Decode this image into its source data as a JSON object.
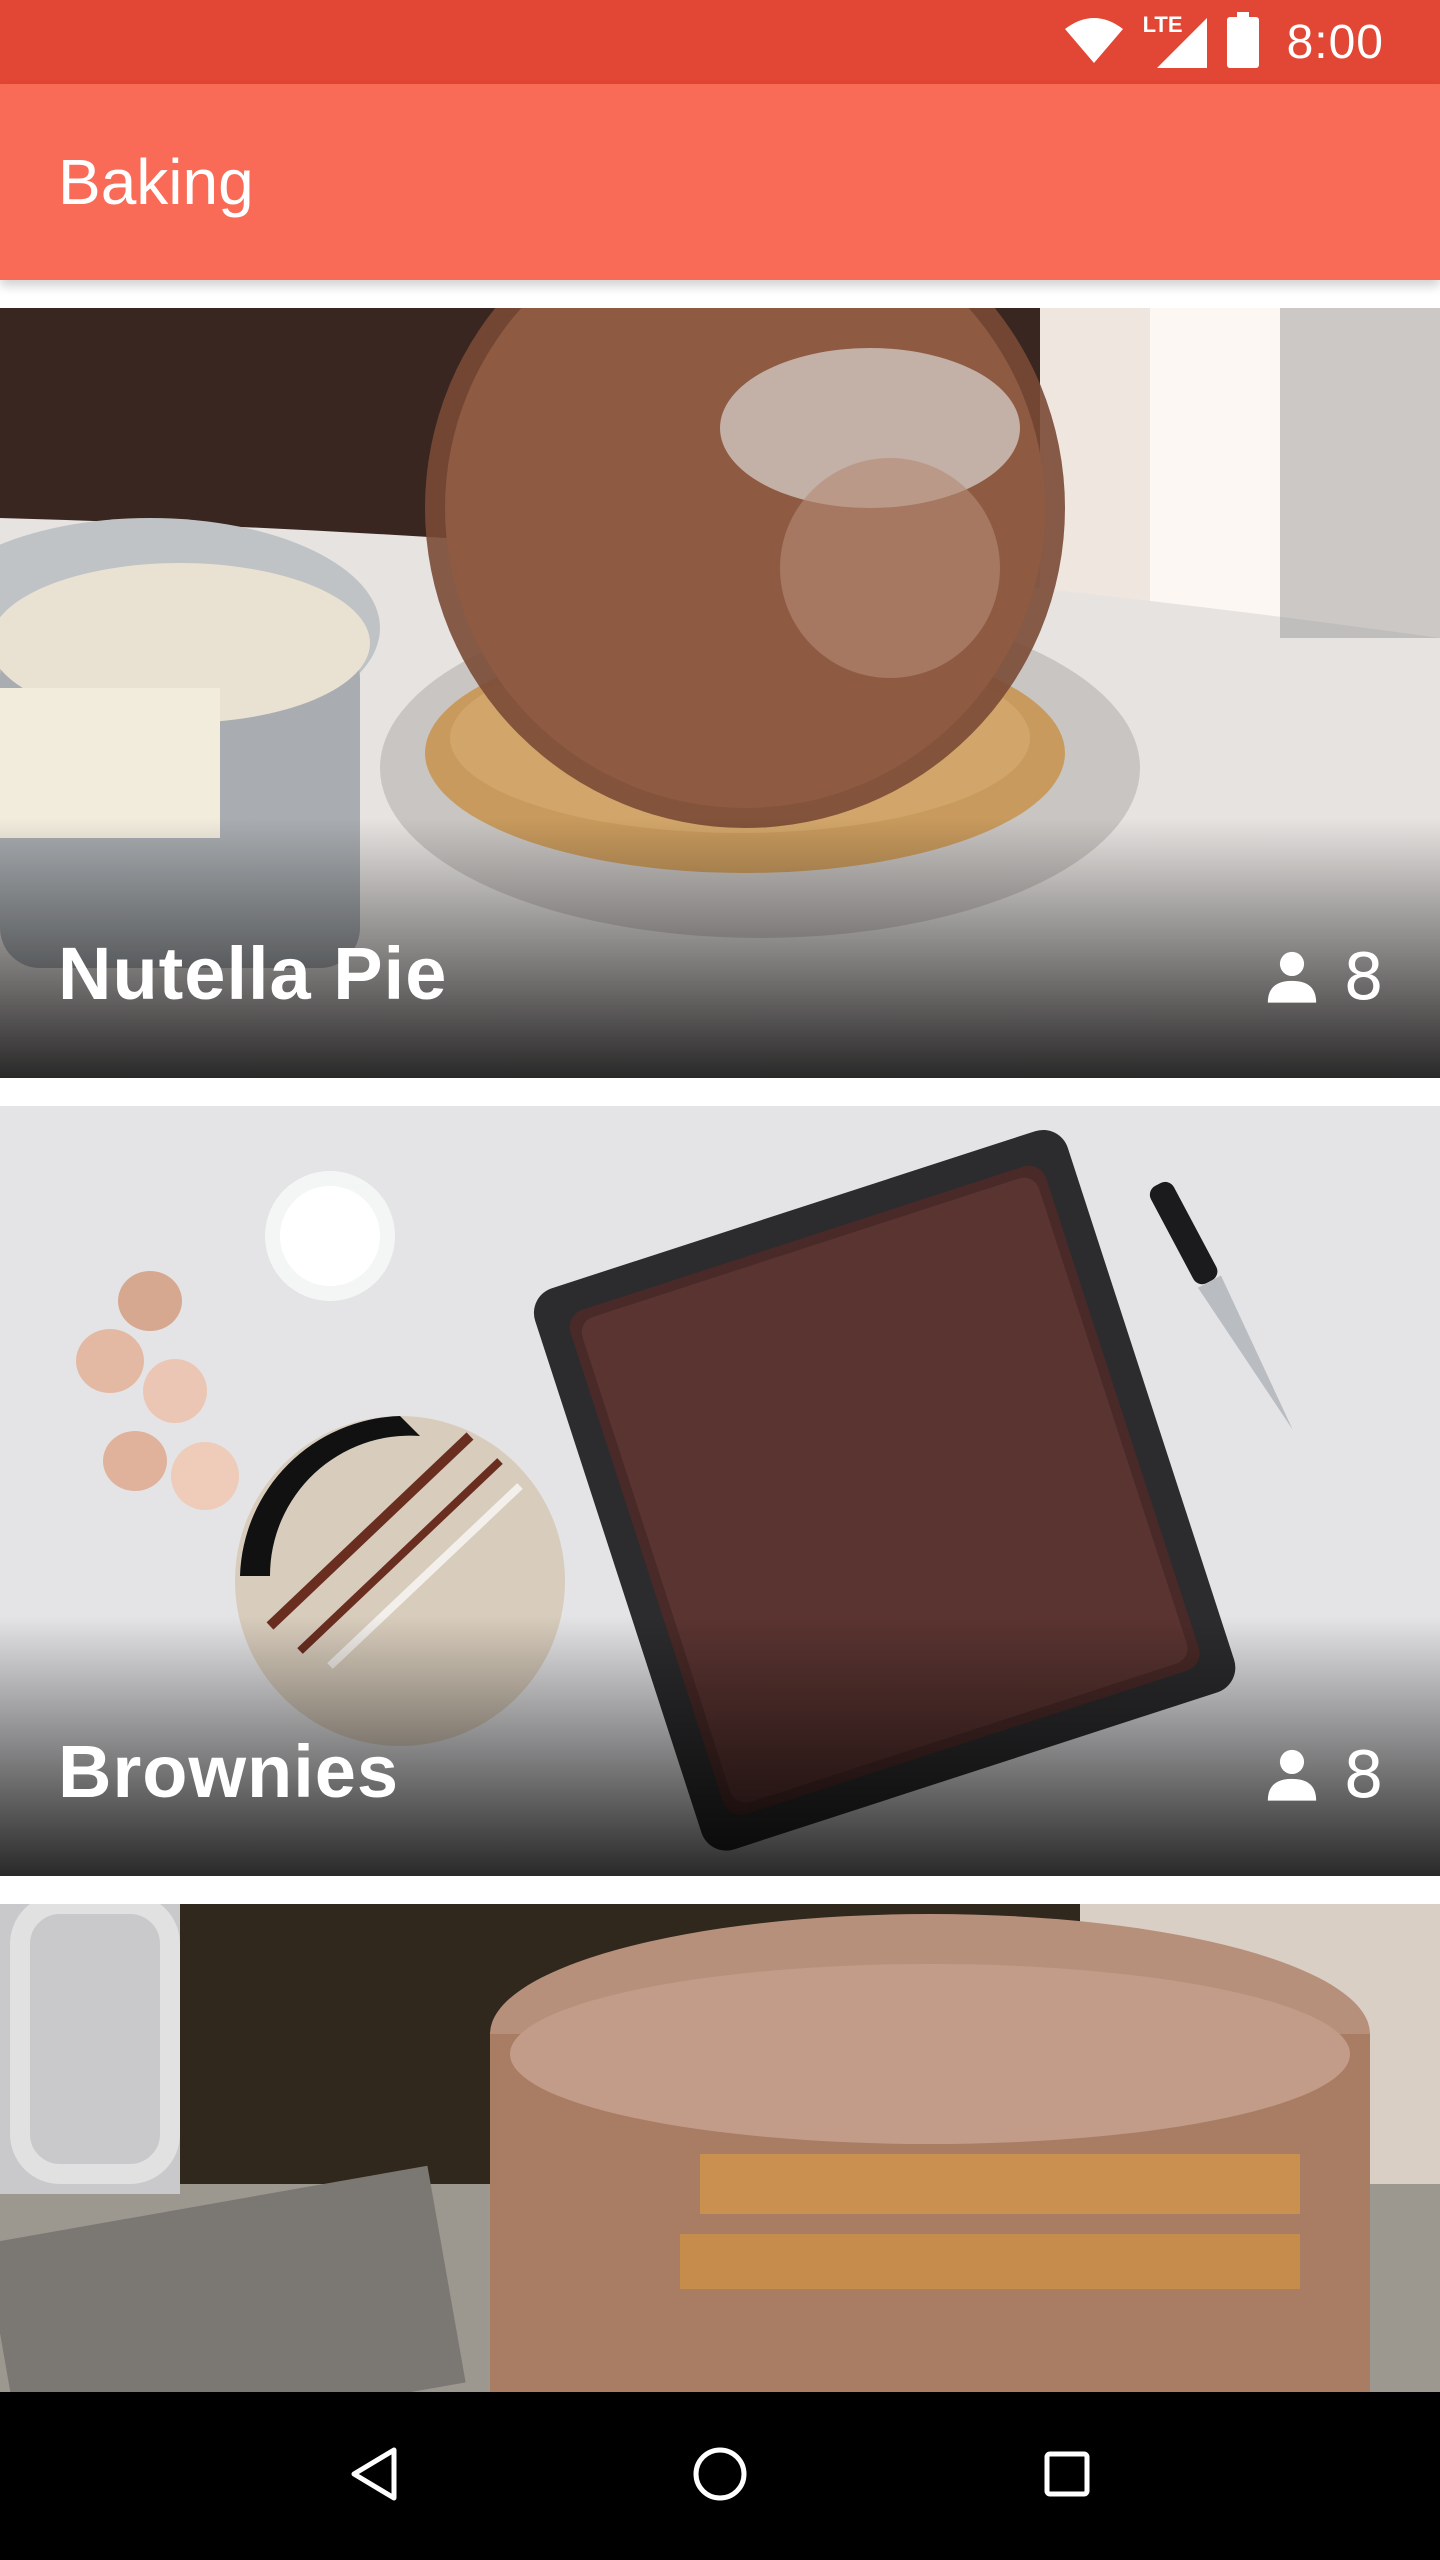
{
  "status_bar": {
    "network_label": "LTE",
    "time": "8:00",
    "icons": [
      "wifi-icon",
      "cell-signal-icon",
      "battery-icon"
    ]
  },
  "app_bar": {
    "title": "Baking"
  },
  "recipes": [
    {
      "name": "Nutella Pie",
      "servings": "8",
      "icon": "person-icon"
    },
    {
      "name": "Brownies",
      "servings": "8",
      "icon": "person-icon"
    },
    {
      "name": "",
      "servings": "",
      "icon": ""
    }
  ],
  "nav_bar": {
    "buttons": [
      "back-icon",
      "home-icon",
      "recents-icon"
    ]
  },
  "colors": {
    "status_bar": "#e24634",
    "app_bar": "#fa6b57",
    "nav_bar": "#000000"
  }
}
